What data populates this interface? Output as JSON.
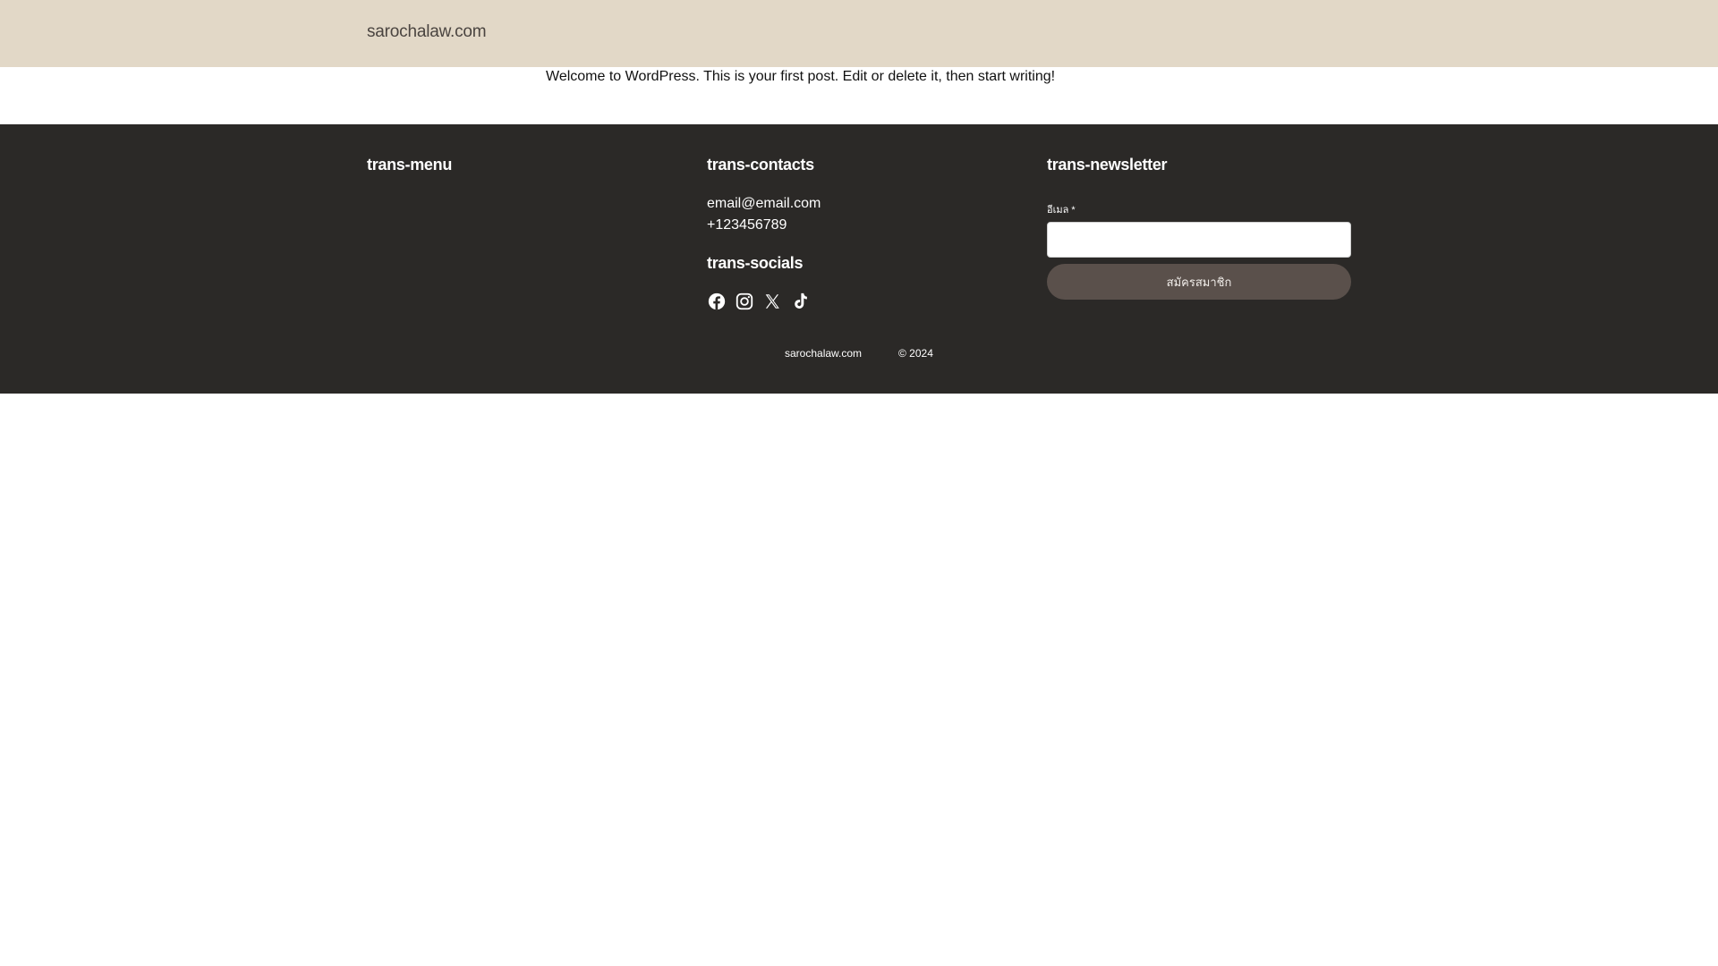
{
  "header": {
    "site_title": "sarochalaw.com"
  },
  "content": {
    "post_text": "Welcome to WordPress. This is your first post. Edit or delete it, then start writing!"
  },
  "footer": {
    "menu": {
      "heading": "trans-menu"
    },
    "contacts": {
      "heading": "trans-contacts",
      "email": "email@email.com",
      "phone": "+123456789"
    },
    "socials": {
      "heading": "trans-socials",
      "icons": [
        "facebook-icon",
        "instagram-icon",
        "x-icon",
        "tiktok-icon"
      ]
    },
    "newsletter": {
      "heading": "trans-newsletter",
      "email_label": "อีเมล *",
      "email_value": "",
      "subscribe_label": "สมัครสมาชิก"
    },
    "bottom": {
      "site_name": "sarochalaw.com",
      "copyright": "© 2024"
    }
  },
  "colors": {
    "header_bg": "#e2d8c7",
    "footer_bg": "#2b2927",
    "button_bg": "#5a504b"
  }
}
